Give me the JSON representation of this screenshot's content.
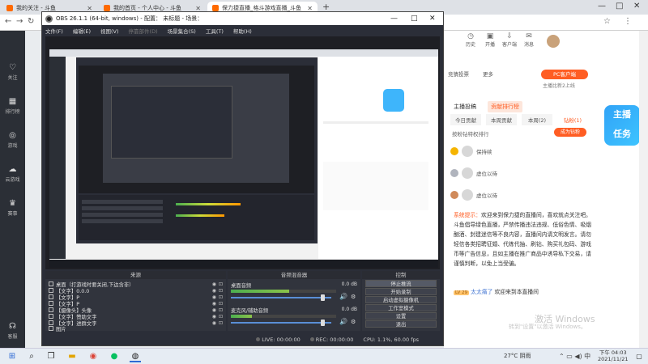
{
  "browser": {
    "tabs": [
      {
        "label": "我的关注 - 斗鱼",
        "active": false
      },
      {
        "label": "我的首页 - 个人中心 - 斗鱼",
        "active": false
      },
      {
        "label": "保力捷直播_格斗游戏直播_斗鱼",
        "active": true
      }
    ],
    "new_tab": "+",
    "window_controls": {
      "minimize": "—",
      "maximize": "□",
      "close": "✕"
    }
  },
  "sidebar": {
    "items": [
      {
        "label": "关注",
        "icon": "heart-icon"
      },
      {
        "label": "排行榜",
        "icon": "chart-icon"
      },
      {
        "label": "游戏",
        "icon": "gamepad-icon"
      },
      {
        "label": "云游戏",
        "icon": "cloud-icon"
      },
      {
        "label": "赛事",
        "icon": "trophy-icon"
      },
      {
        "label": "客服",
        "icon": "headset-icon"
      }
    ]
  },
  "header_icons": [
    {
      "label": "历史",
      "icon": "clock-icon"
    },
    {
      "label": "开播",
      "icon": "camera-icon"
    },
    {
      "label": "客户端",
      "icon": "download-icon"
    },
    {
      "label": "消息",
      "icon": "bell-icon"
    },
    {
      "label": "背包",
      "icon": "bag-icon"
    }
  ],
  "page_right": {
    "room_buttons": [
      "竞猜投票",
      "更多"
    ],
    "pc_client": "PC客户端",
    "pc_client_sub": "主播比新2上线",
    "rank_tabs": [
      "主播投稿",
      "贡献排行榜"
    ],
    "period_tabs": [
      "今日贡献",
      "本周贡献",
      "本周(2)",
      "钻粉(1)"
    ],
    "rank_caption": "按粉钻特权排行",
    "fan_btn": "成为钻粉",
    "rank_rows": [
      {
        "name": "保持续",
        "medal_color": "#f5b400"
      },
      {
        "name": "虚位以待",
        "medal_color": "#b0b4bd"
      },
      {
        "name": "虚位以待",
        "medal_color": "#d08a5a"
      }
    ],
    "system_prefix": "系统提示：",
    "system_msg": "欢迎来到保力捷的直播间，喜欢就点关注吧。斗鱼倡导绿色直播，严禁传播违法违规、低俗色情、吸烟酗酒、封建迷信等不良内容，直播间内请文明发言。请勿轻信各类招聘征婚、代练代抽、刷钻、购买礼包码、游戏币等广告信息，且如主播在推广商品中诱导私下交易，请谨慎判断，以免上当受骗。",
    "chat_level": "LV 29",
    "chat_user": "太太痛了",
    "chat_text": "欢迎来到本直播间",
    "watermark_title": "激活 Windows",
    "watermark_sub": "转到\"设置\"以激活 Windows。"
  },
  "obs": {
    "title": "OBS 26.1.1 (64-bit, windows) - 配置： 未标题 - 场景：",
    "menu": [
      {
        "label": "文件(F)",
        "dim": false
      },
      {
        "label": "编辑(E)",
        "dim": false
      },
      {
        "label": "视图(V)",
        "dim": false
      },
      {
        "label": "停靠部件(D)",
        "dim": true
      },
      {
        "label": "场景集合(S)",
        "dim": false
      },
      {
        "label": "工具(T)",
        "dim": false
      },
      {
        "label": "帮助(H)",
        "dim": false
      }
    ],
    "sources_header": "来源",
    "sources": [
      "桌面（打游戏时要关闭,下边含非）",
      "【文字】0.0.0",
      "【文字】P",
      "【文字】P",
      "【摄像头】头像",
      "【文字】赞助文字",
      "【文字】进群文字",
      "图片"
    ],
    "mixer_header": "音频混音器",
    "mixer": [
      {
        "name": "桌面音频",
        "db": "0.0 dB",
        "level": 0.55,
        "volume": 0.92
      },
      {
        "name": "麦克风/辅助音频",
        "db": "0.0 dB",
        "level": 0.2,
        "volume": 0.92
      }
    ],
    "controls_header": "控制",
    "controls": [
      "停止推流",
      "开始录制",
      "启动虚拟摄像机",
      "工作室模式",
      "设置",
      "退出"
    ],
    "status": {
      "live": "LIVE: 00:00:00",
      "rec": "REC: 00:00:00",
      "cpu": "CPU: 1.1%, 60.00 fps"
    }
  },
  "taskbar": {
    "weather": "27°C 阴雨",
    "time": "下午 04:03",
    "date": "2021/11/21"
  }
}
